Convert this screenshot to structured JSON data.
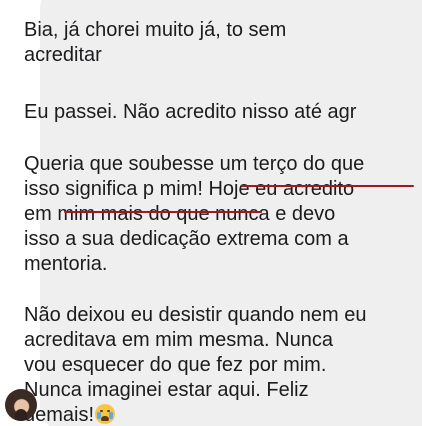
{
  "conversation": {
    "message": {
      "paragraph1": [
        "Bia, já chorei muito já, to sem",
        "acreditar"
      ],
      "paragraph2": [
        "Eu passei. Não acredito nisso até agr"
      ],
      "paragraph3": [
        "Queria que soubesse um terço do que",
        "isso significa p mim! Hoje eu acredito",
        "em mim mais do que nunca e devo",
        "isso a sua dedicação extrema com a",
        "mentoria."
      ],
      "paragraph4": [
        "Não deixou eu desistir quando nem eu",
        "acreditava em mim mesma. Nunca",
        "vou esquecer do que fez por mim.",
        "Nunca imaginei estar aqui. Feliz",
        "demais!"
      ],
      "emoji": "crying-face-icon"
    },
    "annotation_color": "#a0191f",
    "bubble_color": "#efeff0"
  }
}
